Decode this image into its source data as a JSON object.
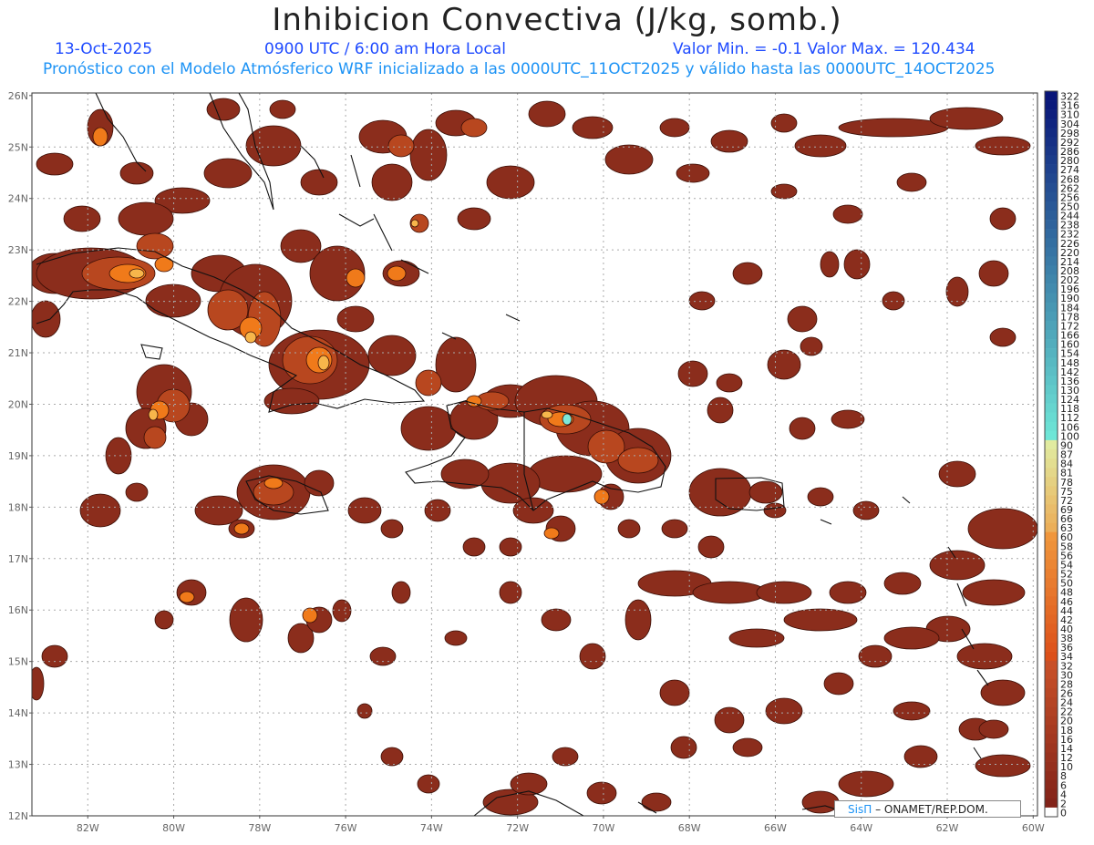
{
  "header": {
    "title": "Inhibicion Convectiva (J/kg, somb.)",
    "date": "13-Oct-2025",
    "time": "0900 UTC / 6:00 am Hora Local",
    "minmax": "Valor Min. = -0.1  Valor Max. = 120.434",
    "forecast": "Pronóstico con el Modelo Atmósferico WRF inicializado a las 0000UTC_11OCT2025 y válido hasta las  0000UTC_14OCT2025"
  },
  "axes": {
    "lat_labels": [
      "26N",
      "25N",
      "24N",
      "23N",
      "22N",
      "21N",
      "20N",
      "19N",
      "18N",
      "17N",
      "16N",
      "15N",
      "14N",
      "13N",
      "12N"
    ],
    "lon_labels": [
      "82W",
      "80W",
      "78W",
      "76W",
      "74W",
      "72W",
      "70W",
      "68W",
      "66W",
      "64W",
      "62W",
      "60W"
    ]
  },
  "colorbar": {
    "labels": [
      "322",
      "316",
      "310",
      "304",
      "298",
      "292",
      "286",
      "280",
      "274",
      "268",
      "262",
      "256",
      "250",
      "244",
      "238",
      "232",
      "226",
      "220",
      "214",
      "208",
      "202",
      "196",
      "190",
      "184",
      "178",
      "172",
      "166",
      "160",
      "154",
      "148",
      "142",
      "136",
      "130",
      "124",
      "118",
      "112",
      "106",
      "100",
      "90",
      "87",
      "84",
      "81",
      "78",
      "75",
      "72",
      "69",
      "66",
      "63",
      "60",
      "58",
      "56",
      "54",
      "52",
      "50",
      "48",
      "46",
      "44",
      "42",
      "40",
      "38",
      "36",
      "34",
      "32",
      "30",
      "28",
      "26",
      "24",
      "22",
      "20",
      "18",
      "16",
      "14",
      "12",
      "10",
      "8",
      "6",
      "4",
      "2",
      "0"
    ]
  },
  "colors": {
    "field_dark": "#8b2d1c",
    "field_mid": "#b8471f",
    "field_orange": "#f07a1a",
    "field_light": "#f7b64b",
    "field_cyan": "#7de8d8",
    "coast": "#111111"
  },
  "credit": {
    "brand": "SisΠ",
    "text": "– ONAMET/REP.DOM."
  }
}
